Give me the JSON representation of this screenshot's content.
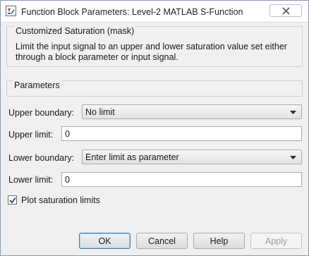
{
  "window": {
    "title": "Function Block Parameters: Level-2 MATLAB S-Function",
    "app_icon": "block-parameters-icon",
    "close_icon": "close-icon"
  },
  "mask": {
    "title": "Customized Saturation (mask)",
    "description": "Limit the input signal to an upper and lower saturation value set either through a block parameter or input signal."
  },
  "parameters": {
    "title": "Parameters",
    "upper_boundary": {
      "label": "Upper boundary:",
      "value": "No limit"
    },
    "upper_limit": {
      "label": "Upper limit:",
      "value": "0"
    },
    "lower_boundary": {
      "label": "Lower boundary:",
      "value": "Enter limit as parameter"
    },
    "lower_limit": {
      "label": "Lower limit:",
      "value": "0"
    },
    "plot_saturation": {
      "label": "Plot saturation limits",
      "checked": true
    }
  },
  "buttons": {
    "ok": "OK",
    "cancel": "Cancel",
    "help": "Help",
    "apply": "Apply"
  }
}
